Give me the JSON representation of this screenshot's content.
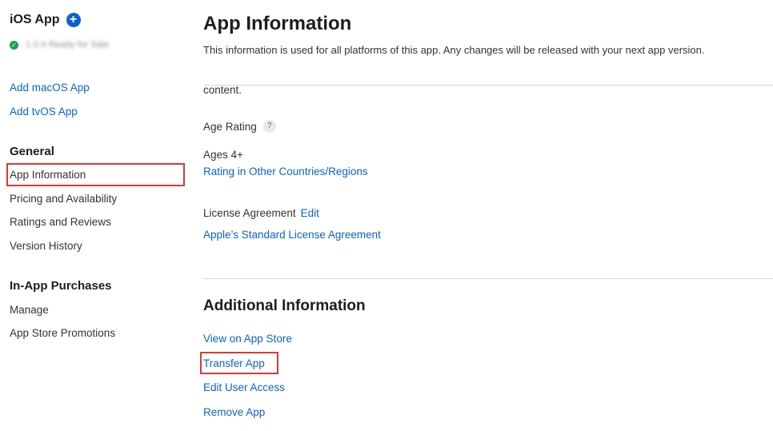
{
  "sidebar": {
    "app_title": "iOS App",
    "add_platform_symbol": "+",
    "status_icon_symbol": "✓",
    "status_text": "1.0.4 Ready for Sale",
    "platform_links": [
      "Add macOS App",
      "Add tvOS App"
    ],
    "general_heading": "General",
    "general_items": [
      "App Information",
      "Pricing and Availability",
      "Ratings and Reviews",
      "Version History"
    ],
    "iap_heading": "In-App Purchases",
    "iap_items": [
      "Manage",
      "App Store Promotions"
    ]
  },
  "main": {
    "title": "App Information",
    "subtitle": "This information is used for all platforms of this app. Any changes will be released with your next app version.",
    "content_fragment": "content.",
    "age_rating": {
      "label": "Age Rating",
      "help_symbol": "?",
      "value": "Ages 4+",
      "link": "Rating in Other Countries/Regions"
    },
    "license": {
      "label": "License Agreement",
      "edit_link": "Edit",
      "link": "Apple’s Standard License Agreement"
    },
    "additional": {
      "title": "Additional Information",
      "links": [
        "View on App Store",
        "Transfer App",
        "Edit User Access",
        "Remove App"
      ]
    }
  },
  "colors": {
    "link": "#0b63c9",
    "highlight": "#d93a35",
    "status_ok": "#24a148"
  }
}
